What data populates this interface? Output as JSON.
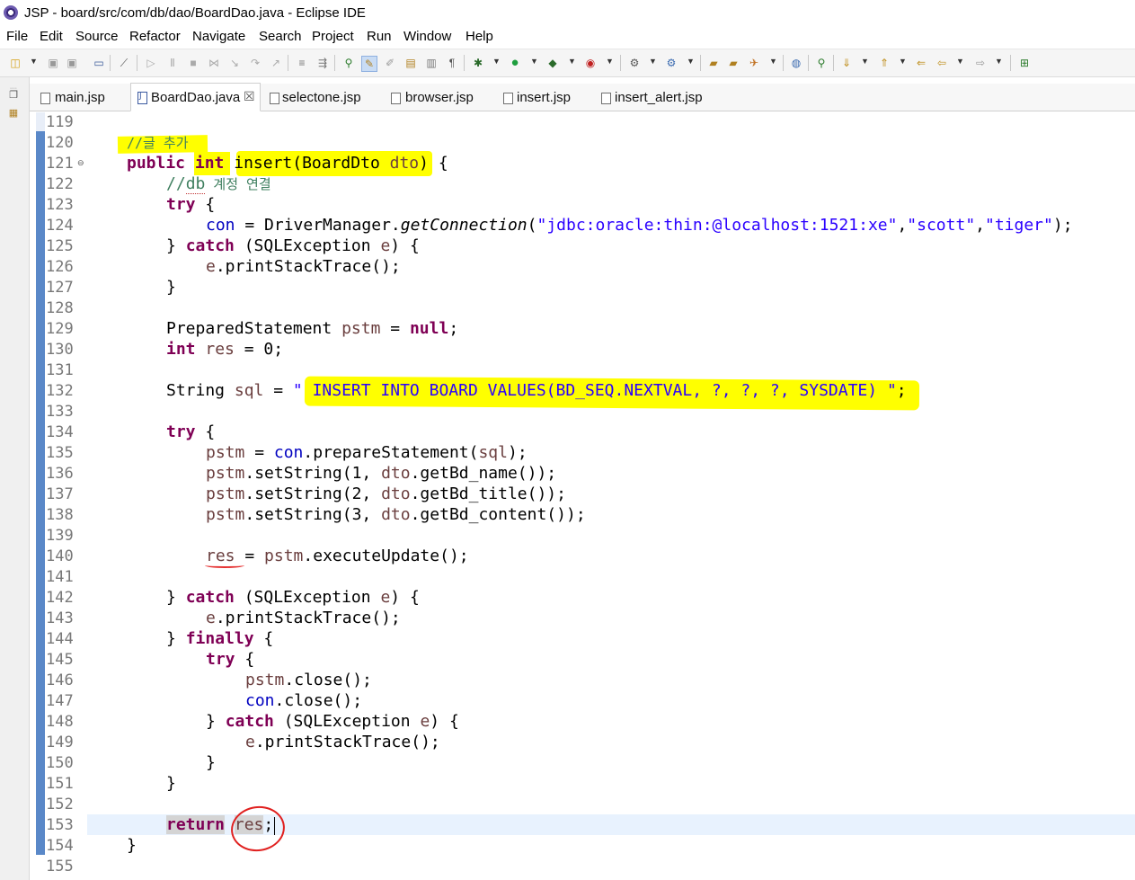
{
  "window": {
    "title": "JSP - board/src/com/db/dao/BoardDao.java - Eclipse IDE"
  },
  "menu": [
    "File",
    "Edit",
    "Source",
    "Refactor",
    "Navigate",
    "Search",
    "Project",
    "Run",
    "Window",
    "Help"
  ],
  "tabs": [
    {
      "label": "main.jsp",
      "active": false
    },
    {
      "label": "BoardDao.java",
      "active": true,
      "close": "☒"
    },
    {
      "label": "selectone.jsp",
      "active": false
    },
    {
      "label": "browser.jsp",
      "active": false
    },
    {
      "label": "insert.jsp",
      "active": false
    },
    {
      "label": "insert_alert.jsp",
      "active": false
    }
  ],
  "editor": {
    "line_numbers": [
      "119",
      "120",
      "121",
      "122",
      "123",
      "124",
      "125",
      "126",
      "127",
      "128",
      "129",
      "130",
      "131",
      "132",
      "133",
      "134",
      "135",
      "136",
      "137",
      "138",
      "139",
      "140",
      "141",
      "142",
      "143",
      "144",
      "145",
      "146",
      "147",
      "148",
      "149",
      "150",
      "151",
      "152",
      "153",
      "154",
      "155"
    ],
    "lines": {
      "l120": {
        "comment": "//글 추가"
      },
      "l121": {
        "kw_public": "public",
        "kw_int": "int",
        "method": " insert(BoardDto ",
        "param": "dto",
        "rest": ") {"
      },
      "l122": {
        "comment_a": "//",
        "comment_b": "db",
        "comment_c": " 계정 연결"
      },
      "l123": {
        "kw": "try",
        "rest": " {"
      },
      "l124": {
        "field": "con",
        "a": " = DriverManager.",
        "method": "getConnection",
        "b": "(",
        "s1": "\"jdbc:oracle:thin:@localhost:1521:xe\"",
        "c": ",",
        "s2": "\"scott\"",
        "d": ",",
        "s3": "\"tiger\"",
        "e": ");"
      },
      "l125": {
        "a": "} ",
        "kw": "catch",
        "b": " (SQLException ",
        "var": "e",
        "c": ") {"
      },
      "l126": {
        "var": "e",
        "rest": ".printStackTrace();"
      },
      "l127": {
        "text": "}"
      },
      "l129": {
        "a": "PreparedStatement ",
        "var": "pstm",
        "b": " = ",
        "kw": "null",
        "c": ";"
      },
      "l130": {
        "kw": "int",
        "a": " ",
        "var": "res",
        "b": " = 0;"
      },
      "l132": {
        "a": "String ",
        "var": "sql",
        "b": " = ",
        "str": "\" INSERT INTO BOARD VALUES(BD_SEQ.NEXTVAL, ?, ?, ?, SYSDATE) \"",
        "c": ";"
      },
      "l134": {
        "kw": "try",
        "rest": " {"
      },
      "l135": {
        "var": "pstm",
        "a": " = ",
        "field": "con",
        "b": ".prepareStatement(",
        "var2": "sql",
        "c": ");"
      },
      "l136": {
        "var": "pstm",
        "a": ".setString(1, ",
        "var2": "dto",
        "b": ".getBd_name());"
      },
      "l137": {
        "var": "pstm",
        "a": ".setString(2, ",
        "var2": "dto",
        "b": ".getBd_title());"
      },
      "l138": {
        "var": "pstm",
        "a": ".setString(3, ",
        "var2": "dto",
        "b": ".getBd_content());"
      },
      "l140": {
        "var": "res",
        "a": " = ",
        "var2": "pstm",
        "b": ".executeUpdate();"
      },
      "l142": {
        "a": "} ",
        "kw": "catch",
        "b": " (SQLException ",
        "var": "e",
        "c": ") {"
      },
      "l143": {
        "var": "e",
        "rest": ".printStackTrace();"
      },
      "l144": {
        "a": "} ",
        "kw": "finally",
        "b": " {"
      },
      "l145": {
        "kw": "try",
        "rest": " {"
      },
      "l146": {
        "var": "pstm",
        "rest": ".close();"
      },
      "l147": {
        "field": "con",
        "rest": ".close();"
      },
      "l148": {
        "a": "} ",
        "kw": "catch",
        "b": " (SQLException ",
        "var": "e",
        "c": ") {"
      },
      "l149": {
        "var": "e",
        "rest": ".printStackTrace();"
      },
      "l150": {
        "text": "}"
      },
      "l151": {
        "text": "}"
      },
      "l153": {
        "kw": "return",
        "a": " ",
        "var": "res",
        "b": ";"
      },
      "l154": {
        "text": "}"
      }
    }
  },
  "colors": {
    "keyword": "#7f0055",
    "string": "#2a00ff",
    "field": "#0000c0",
    "local_variable": "#6a3e3e",
    "comment": "#3f7f5f",
    "highlighter": "#ffff00",
    "annotation_red": "#e0201f"
  },
  "toolbar_icons": [
    "new-icon",
    "save-icon",
    "save-all-icon",
    "terminal-icon",
    "skip-breakpoints-icon",
    "resume-icon",
    "suspend-icon",
    "terminate-icon",
    "disconnect-icon",
    "step-into-icon",
    "step-over-icon",
    "step-return-icon",
    "drop-to-frame-icon",
    "use-step-filters-icon",
    "open-type-icon",
    "toggle-mark-occurrences-icon",
    "highlight-icon",
    "java-perspective-icon",
    "show-whitespace-icon",
    "debug-icon",
    "run-icon",
    "coverage-icon",
    "external-tools-icon",
    "new-server-icon",
    "new-java-project-icon",
    "new-package-icon",
    "new-class-icon",
    "open-task-icon",
    "search-icon",
    "globe-icon",
    "next-annotation-icon",
    "previous-annotation-icon",
    "last-edit-icon",
    "back-icon",
    "forward-icon",
    "open-perspective-icon"
  ],
  "side_trim_icons": [
    "restore-icon",
    "package-explorer-icon"
  ]
}
